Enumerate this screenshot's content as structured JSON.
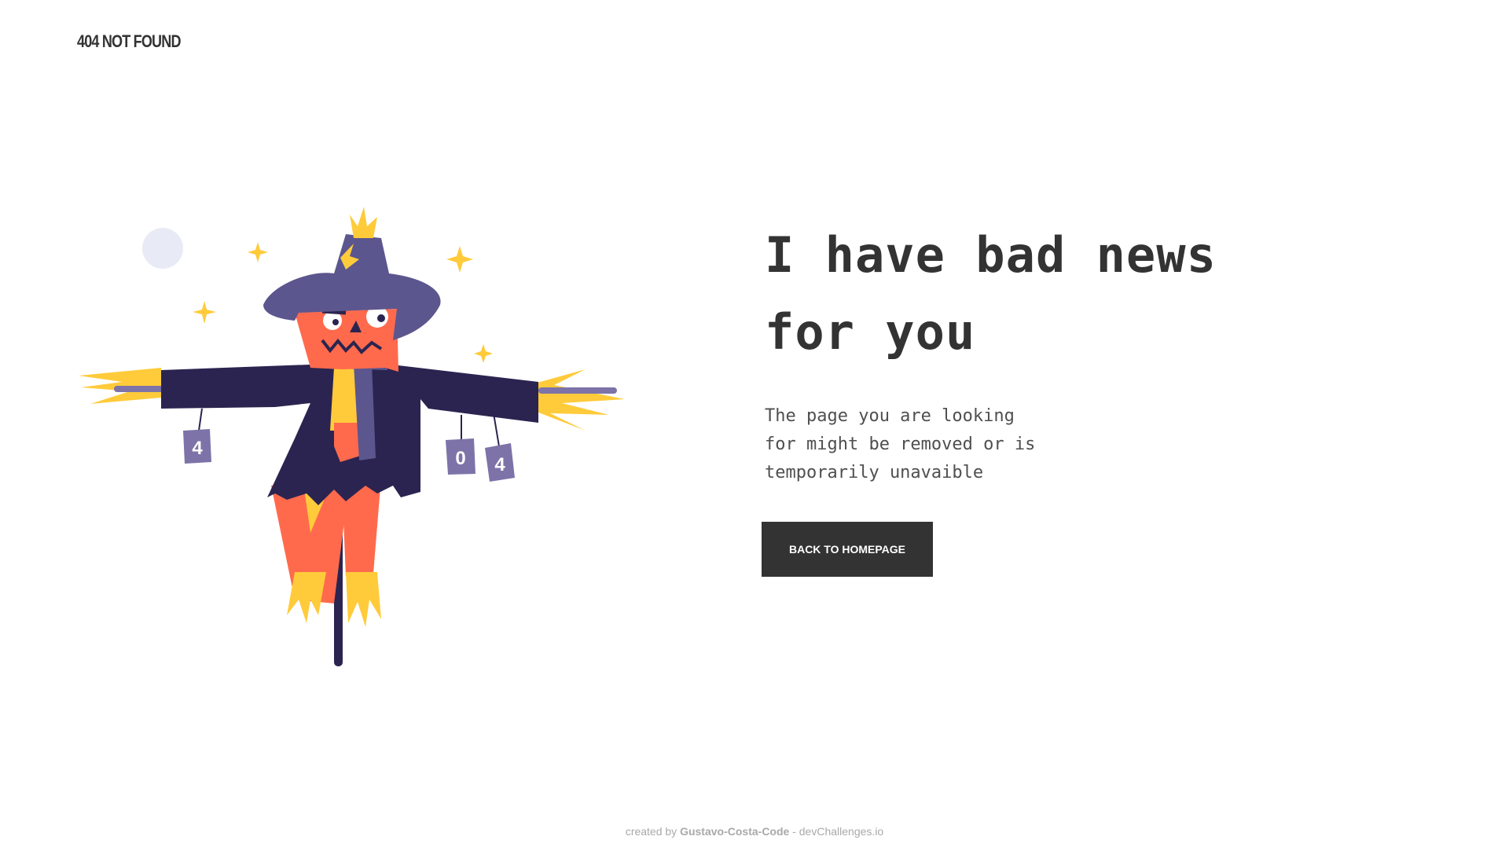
{
  "header": {
    "brand": "404 NOT FOUND"
  },
  "illustration": {
    "icon": "scarecrow-illustration",
    "can_labels": [
      "4",
      "0",
      "4"
    ]
  },
  "main": {
    "headline_line1": "I have bad news",
    "headline_line2": "for you",
    "description_line1": "The page you are looking",
    "description_line2": "for might be removed or is",
    "description_line3": "temporarily unavaible",
    "button_label": "BACK TO HOMEPAGE"
  },
  "footer": {
    "prefix": "created by",
    "author": "Gustavo-Costa-Code",
    "separator": "-",
    "site": "devChallenges.io"
  },
  "colors": {
    "text": "#333333",
    "button_bg": "#333333",
    "button_text": "#ffffff",
    "footer_text": "#a9a9a9",
    "hat": "#5c568e",
    "coat": "#2b2450",
    "face": "#ff6a4d",
    "straw": "#ffcb3b",
    "can": "#7d73a8",
    "moon": "#e8ebf5"
  }
}
